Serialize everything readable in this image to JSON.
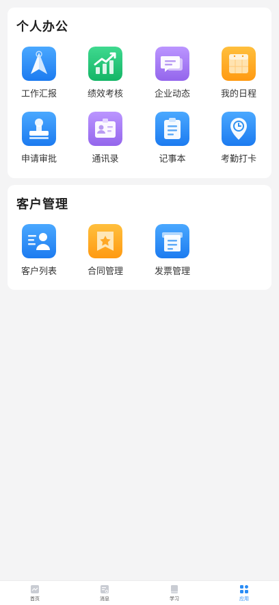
{
  "sections": {
    "personal": {
      "title": "个人办公",
      "items": [
        {
          "label": "工作汇报",
          "icon": "paper-plane-icon",
          "color": "#2d8ff0"
        },
        {
          "label": "绩效考核",
          "icon": "bar-chart-trend-icon",
          "color": "#1fc37a"
        },
        {
          "label": "企业动态",
          "icon": "chat-bubbles-icon",
          "color": "#a77af0"
        },
        {
          "label": "我的日程",
          "icon": "calendar-icon",
          "color": "#ffa826"
        },
        {
          "label": "申请审批",
          "icon": "stamp-icon",
          "color": "#2d8ff0"
        },
        {
          "label": "通讯录",
          "icon": "contact-card-icon",
          "color": "#a77af0"
        },
        {
          "label": "记事本",
          "icon": "notepad-icon",
          "color": "#2d8ff0"
        },
        {
          "label": "考勤打卡",
          "icon": "location-clock-icon",
          "color": "#2d8ff0"
        }
      ]
    },
    "customer": {
      "title": "客户管理",
      "items": [
        {
          "label": "客户列表",
          "icon": "customer-list-icon",
          "color": "#2d8ff0"
        },
        {
          "label": "合同管理",
          "icon": "contract-star-icon",
          "color": "#ffa826"
        },
        {
          "label": "发票管理",
          "icon": "invoice-icon",
          "color": "#2d8ff0"
        }
      ]
    }
  },
  "tabbar": {
    "active_color": "#2a8cf5",
    "items": [
      {
        "label": "首页",
        "icon": "home-chart-icon"
      },
      {
        "label": "消息",
        "icon": "message-icon"
      },
      {
        "label": "学习",
        "icon": "book-icon"
      },
      {
        "label": "应用",
        "icon": "apps-grid-icon",
        "active": true
      }
    ]
  }
}
